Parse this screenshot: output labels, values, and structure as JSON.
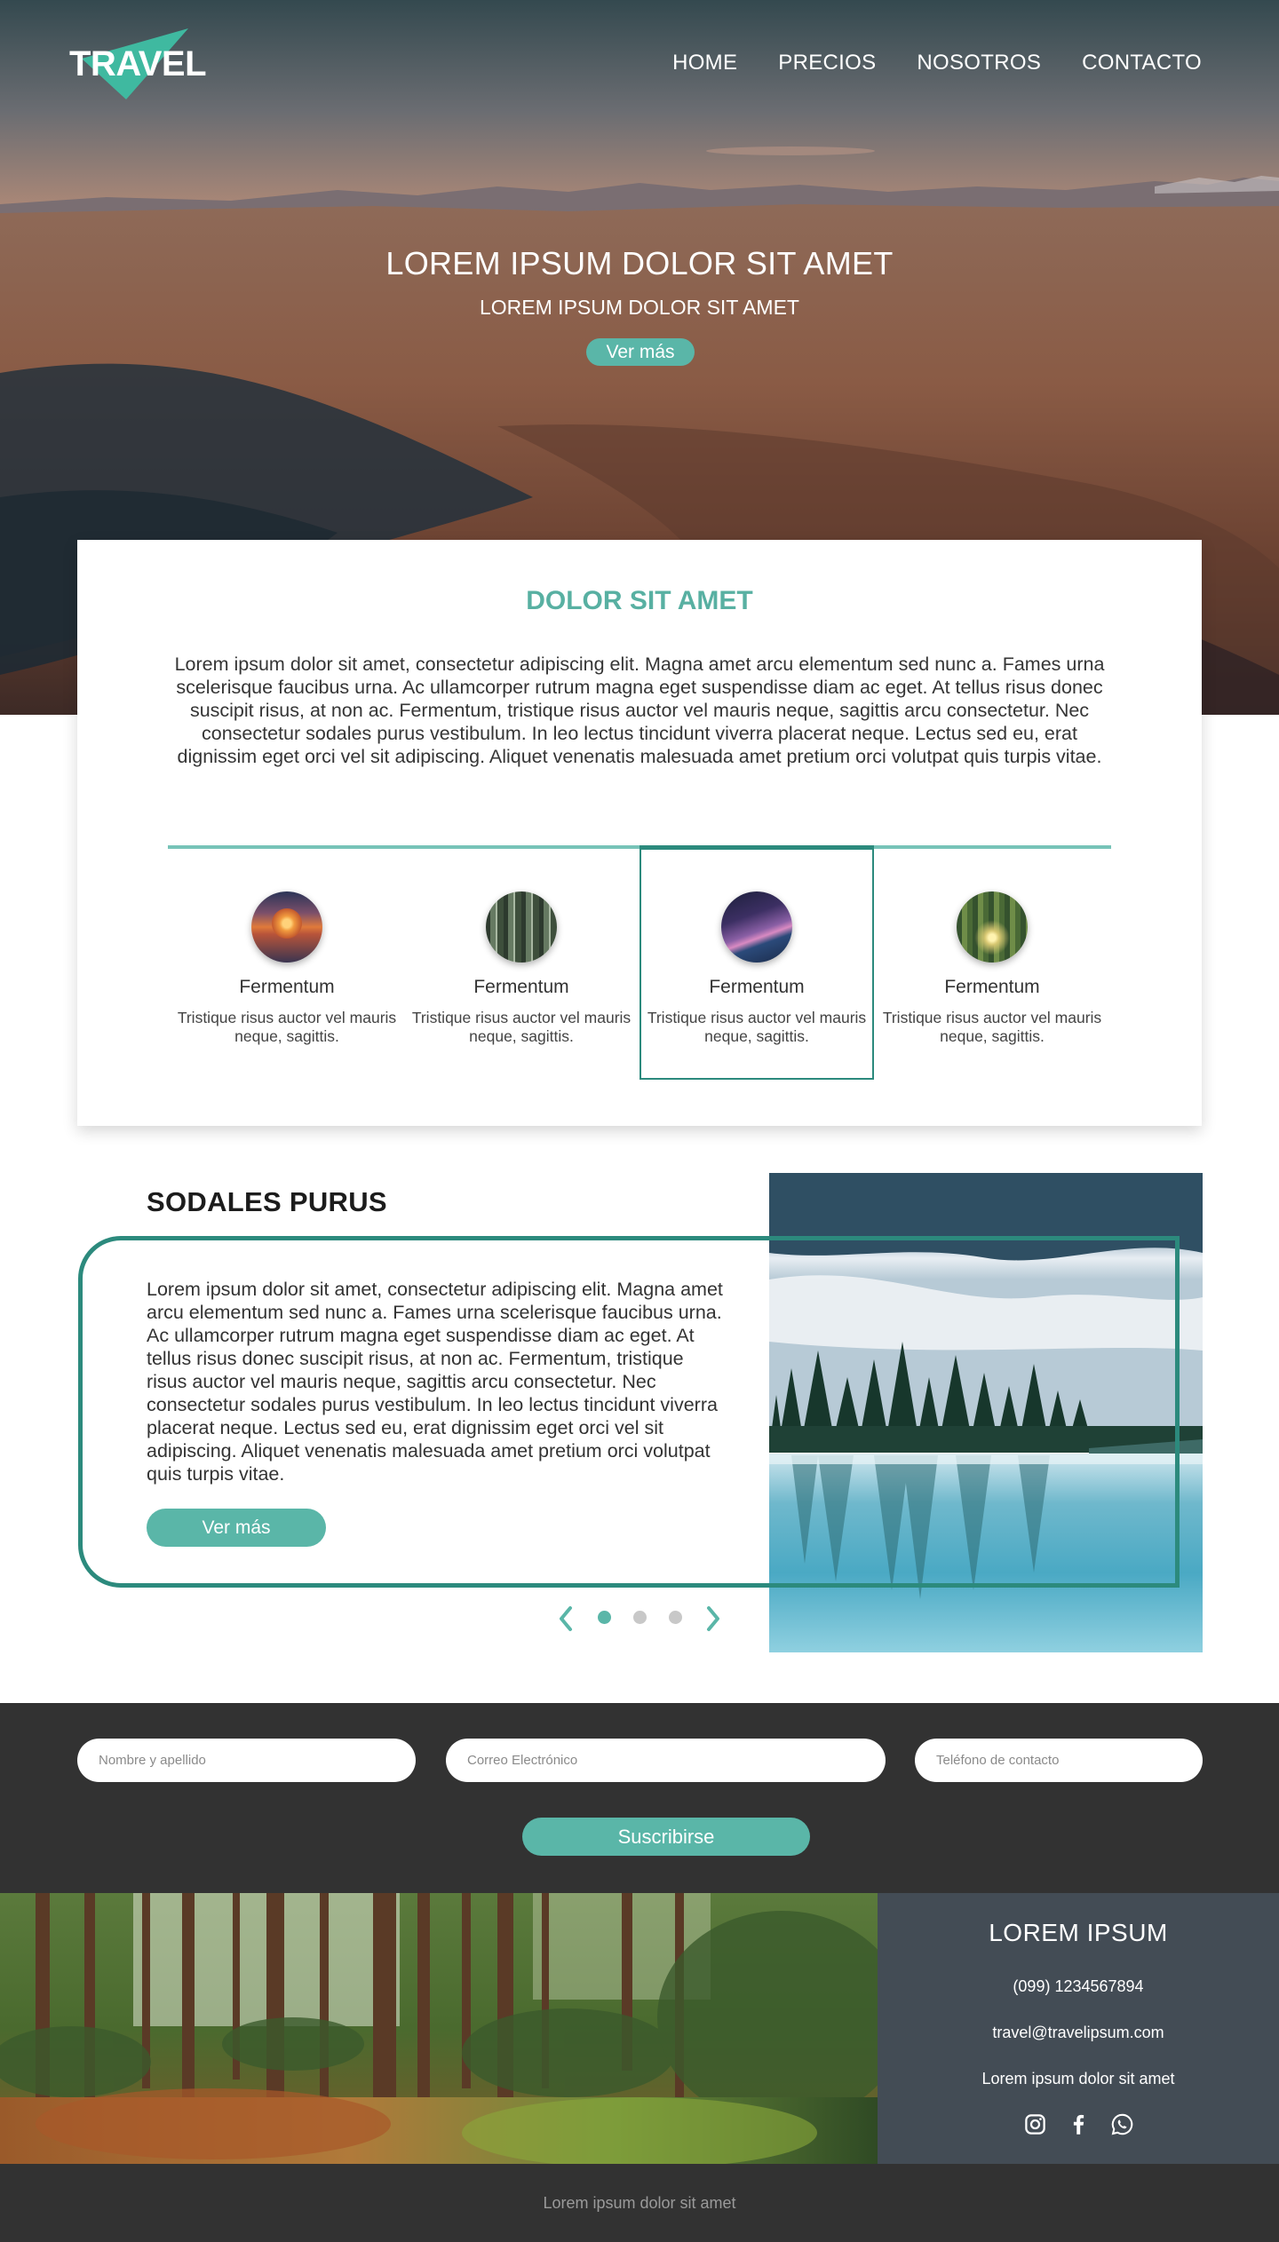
{
  "brand": {
    "name": "TRAVEL",
    "accent": "#5ab6a8",
    "dark_accent": "#2c8a7d",
    "logo_color": "#3fb9a0"
  },
  "nav": {
    "items": [
      {
        "label": "HOME"
      },
      {
        "label": "PRECIOS"
      },
      {
        "label": "NOSOTROS"
      },
      {
        "label": "CONTACTO"
      }
    ]
  },
  "hero": {
    "title": "LOREM IPSUM DOLOR SIT AMET",
    "subtitle": "LOREM IPSUM DOLOR SIT AMET",
    "cta": "Ver más"
  },
  "intro": {
    "title": "DOLOR SIT AMET",
    "text": "Lorem ipsum dolor sit amet, consectetur adipiscing elit. Magna amet arcu elementum sed nunc a. Fames urna scelerisque faucibus urna. Ac ullamcorper rutrum magna eget suspendisse diam ac eget. At tellus risus donec suscipit risus, at non ac. Fermentum, tristique risus auctor vel mauris neque, sagittis arcu consectetur. Nec consectetur sodales purus vestibulum. In leo lectus tincidunt viverra placerat neque. Lectus sed eu, erat dignissim eget orci vel sit adipiscing. Aliquet venenatis malesuada amet pretium orci volutpat quis turpis vitae.",
    "features": [
      {
        "title": "Fermentum",
        "text": "Tristique risus auctor vel mauris neque, sagittis.",
        "image": "sunset-photo",
        "selected": false
      },
      {
        "title": "Fermentum",
        "text": "Tristique risus auctor vel mauris neque, sagittis.",
        "image": "forest-photo",
        "selected": false
      },
      {
        "title": "Fermentum",
        "text": "Tristique risus auctor vel mauris neque, sagittis.",
        "image": "night-sky-photo",
        "selected": true
      },
      {
        "title": "Fermentum",
        "text": "Tristique risus auctor vel mauris neque, sagittis.",
        "image": "sunlit-forest-photo",
        "selected": false
      }
    ]
  },
  "sodales": {
    "title": "SODALES PURUS",
    "text": "Lorem ipsum dolor sit amet, consectetur adipiscing elit. Magna amet arcu elementum sed nunc a. Fames urna scelerisque faucibus urna. Ac ullamcorper rutrum magna eget suspendisse diam ac eget. At tellus risus donec suscipit risus, at non ac. Fermentum, tristique risus auctor vel mauris neque, sagittis arcu consectetur. Nec consectetur sodales purus vestibulum. In leo lectus tincidunt viverra placerat neque. Lectus sed eu, erat dignissim eget orci vel sit adipiscing. Aliquet venenatis malesuada amet pretium orci volutpat quis turpis vitae.",
    "cta": "Ver más",
    "carousel": {
      "active_index": 0,
      "count": 3
    }
  },
  "subscribe": {
    "name_placeholder": "Nombre y apellido",
    "email_placeholder": "Correo Electrónico",
    "phone_placeholder": "Teléfono de contacto",
    "button": "Suscribirse"
  },
  "contact": {
    "title": "LOREM IPSUM",
    "phone": "(099) 1234567894",
    "email": "travel@travelipsum.com",
    "tagline": "Lorem ipsum dolor sit amet",
    "socials": [
      "instagram-icon",
      "facebook-icon",
      "whatsapp-icon"
    ]
  },
  "footer": {
    "text": "Lorem ipsum dolor sit amet"
  }
}
